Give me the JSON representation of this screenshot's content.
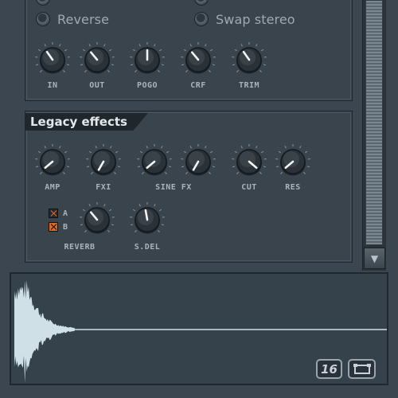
{
  "options": {
    "reverse_label": "Reverse",
    "swap_stereo_label": "Swap stereo"
  },
  "top_knobs": [
    {
      "label": "IN"
    },
    {
      "label": "OUT"
    },
    {
      "label": "POGO"
    },
    {
      "label": "CRF"
    },
    {
      "label": "TRIM"
    }
  ],
  "legacy": {
    "title": "Legacy effects",
    "knobs": [
      {
        "label": "AMP"
      },
      {
        "label": "FXI"
      },
      {
        "label": "SINE FX"
      },
      {
        "label": "CUT"
      },
      {
        "label": "RES"
      }
    ],
    "reverb_label": "REVERB",
    "sdel_label": "S.DEL",
    "reverb_a": "A",
    "reverb_b": "B"
  },
  "waveform": {
    "resolution_button": "16"
  },
  "colors": {
    "accent": "#e06a1f",
    "background": "#3b4650",
    "waveform": "#cfe0e6"
  }
}
